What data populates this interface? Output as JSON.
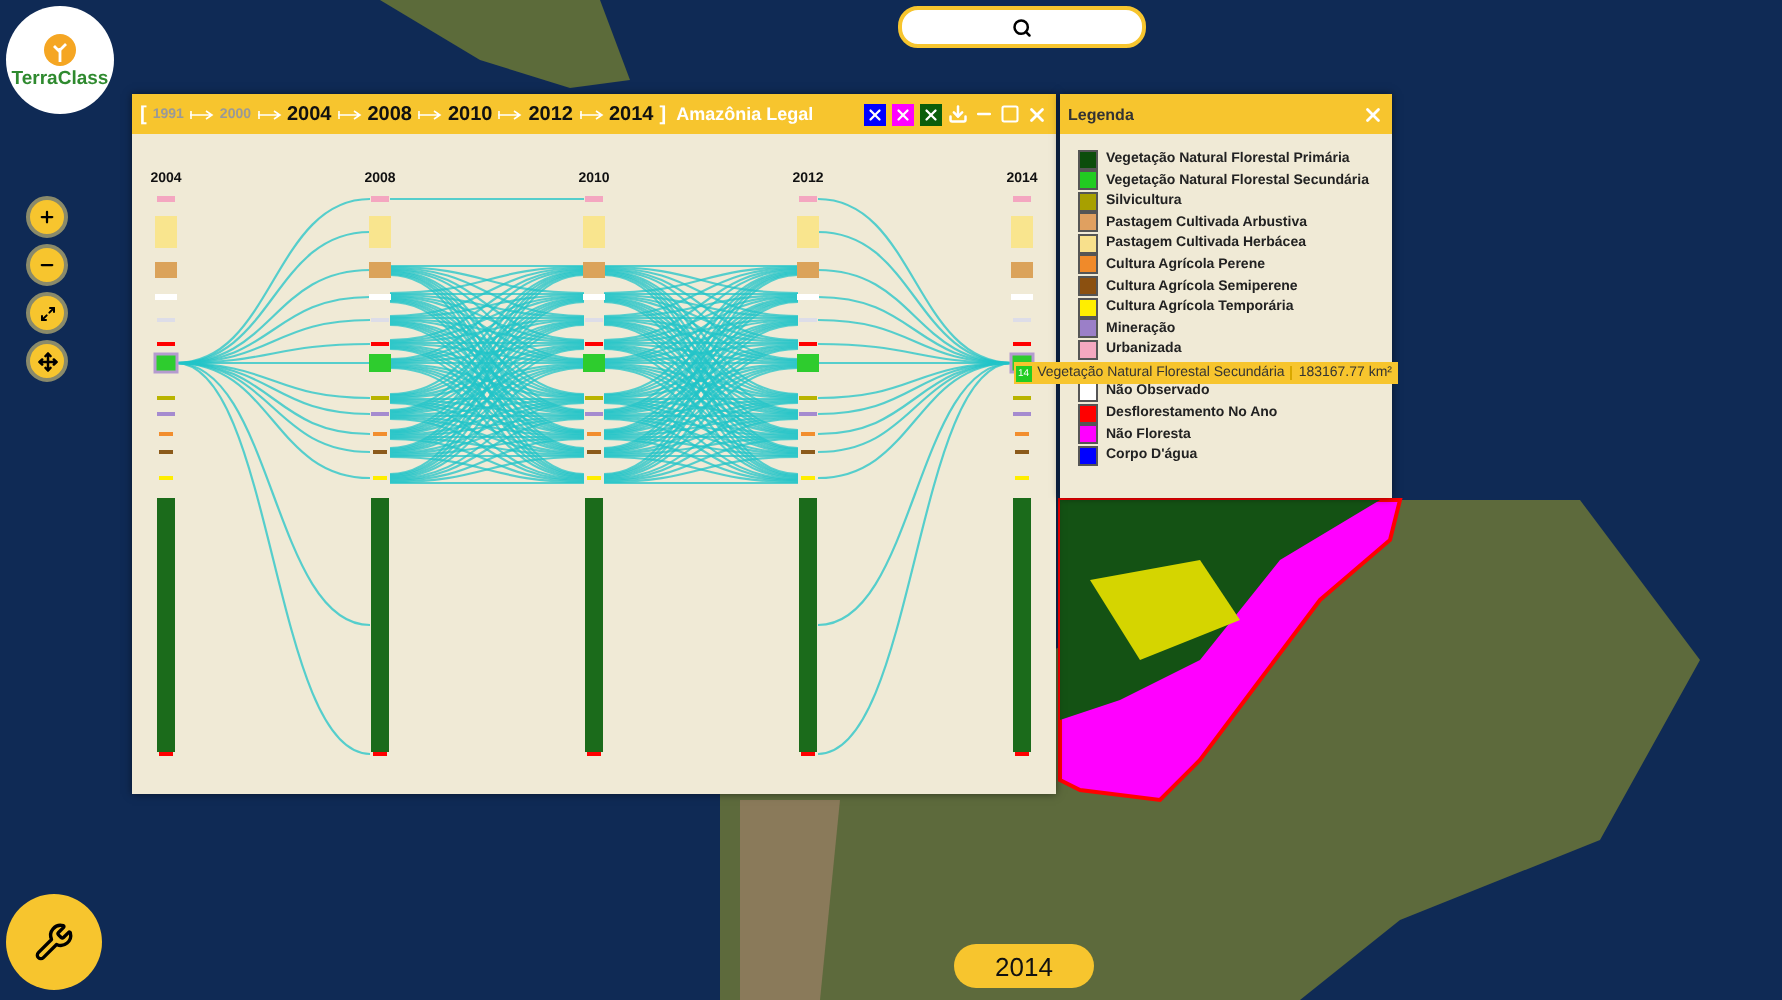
{
  "logo": {
    "text": "TerraClass"
  },
  "sankey_window": {
    "open_bracket": "[",
    "close_bracket": "]",
    "title": "Amazônia Legal",
    "years": [
      {
        "label": "1991",
        "enabled": false
      },
      {
        "label": "2000",
        "enabled": false
      },
      {
        "label": "2004",
        "enabled": true
      },
      {
        "label": "2008",
        "enabled": true
      },
      {
        "label": "2010",
        "enabled": true
      },
      {
        "label": "2012",
        "enabled": true
      },
      {
        "label": "2014",
        "enabled": true
      }
    ],
    "filter_buttons": [
      {
        "color": "#0000ff"
      },
      {
        "color": "#ff00ff"
      },
      {
        "color": "#0b5d0b"
      }
    ],
    "columns": [
      "2004",
      "2008",
      "2010",
      "2012",
      "2014"
    ]
  },
  "tooltip": {
    "badge": "14",
    "label": "Vegetação Natural Florestal Secundária",
    "value": "183167.77 km²",
    "color": "#22cc22"
  },
  "legend": {
    "title": "Legenda",
    "items": [
      {
        "label": "Vegetação Natural Florestal Primária",
        "color": "#0b4d0b"
      },
      {
        "label": "Vegetação Natural Florestal Secundária",
        "color": "#22cc22"
      },
      {
        "label": "Silvicultura",
        "color": "#a8a000"
      },
      {
        "label": "Pastagem Cultivada Arbustiva",
        "color": "#e0a060"
      },
      {
        "label": "Pastagem Cultivada Herbácea",
        "color": "#f8e08c"
      },
      {
        "label": "Cultura Agrícola Perene",
        "color": "#f08a2a"
      },
      {
        "label": "Cultura Agrícola Semiperene",
        "color": "#8b5010"
      },
      {
        "label": "Cultura Agrícola Temporária",
        "color": "#ffee00"
      },
      {
        "label": "Mineração",
        "color": "#9b7fc8"
      },
      {
        "label": "Urbanizada",
        "color": "#f4a8c0"
      }
    ],
    "items_after_tooltip": [
      {
        "label": "Não Observado",
        "color": "#ffffff"
      },
      {
        "label": "Desflorestamento No Ano",
        "color": "#ff0000"
      },
      {
        "label": "Não Floresta",
        "color": "#ff00ff"
      },
      {
        "label": "Corpo D'água",
        "color": "#0000ff"
      }
    ]
  },
  "year_badge": "2014"
}
